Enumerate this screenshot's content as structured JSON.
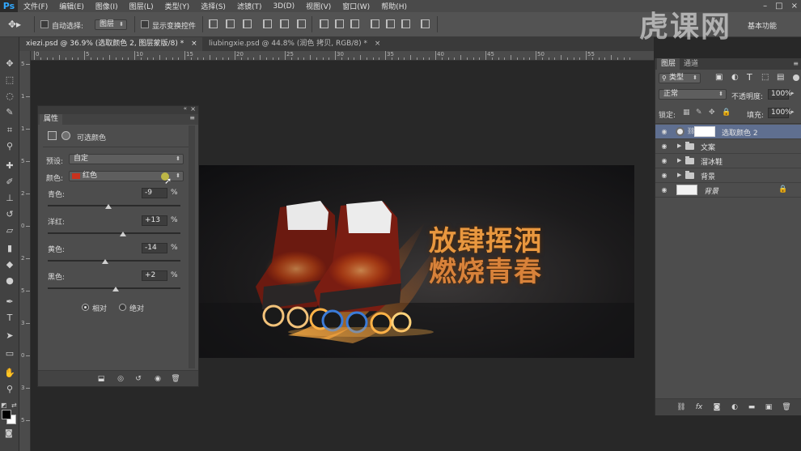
{
  "app": {
    "logo": "Ps"
  },
  "menu": [
    "文件(F)",
    "编辑(E)",
    "图像(I)",
    "图层(L)",
    "类型(Y)",
    "选择(S)",
    "滤镜(T)",
    "3D(D)",
    "视图(V)",
    "窗口(W)",
    "帮助(H)"
  ],
  "options": {
    "auto_select_label": "自动选择:",
    "auto_select_value": "图层",
    "show_transform_label": "显示变换控件",
    "right_text": "基本功能"
  },
  "tabs": [
    {
      "label": "xiezi.psd @ 36.9% (选取颜色 2, 图层蒙版/8) *",
      "close": "×"
    },
    {
      "label": "liubingxie.psd @ 44.8% (润色 拷贝, RGB/8) *",
      "close": "×"
    }
  ],
  "ruler": {
    "top": [
      "0",
      "5",
      "10",
      "15",
      "20",
      "25",
      "30",
      "35",
      "40",
      "45",
      "50",
      "55"
    ],
    "left": [
      "5",
      "1",
      "1",
      "5",
      "2",
      "0",
      "2",
      "5",
      "3",
      "0",
      "3",
      "5"
    ]
  },
  "properties": {
    "tab": "属性",
    "title": "可选颜色",
    "preset_label": "预设:",
    "preset_value": "自定",
    "color_label": "颜色:",
    "color_value": "红色",
    "color_swatch": "#c8321e",
    "sliders": [
      {
        "label": "青色:",
        "value": "-9",
        "unit": "%",
        "level": -9
      },
      {
        "label": "洋红:",
        "value": "+13",
        "unit": "%",
        "level": 13
      },
      {
        "label": "黄色:",
        "value": "-14",
        "unit": "%",
        "level": -14
      },
      {
        "label": "黑色:",
        "value": "+2",
        "unit": "%",
        "level": 2
      }
    ],
    "mode_relative": "相对",
    "mode_absolute": "绝对",
    "mode_selected": "相对"
  },
  "banner": {
    "line1": "放肆挥洒",
    "line2": "燃烧青春"
  },
  "layers_panel": {
    "tab_layers": "图层",
    "tab_channels": "通道",
    "filter_label": "类型",
    "blend_mode": "正常",
    "opacity_label": "不透明度:",
    "opacity_value": "100%",
    "lock_label": "锁定:",
    "fill_label": "填充:",
    "fill_value": "100%",
    "layers": [
      {
        "name": "选取颜色 2",
        "type": "adjustment",
        "selected": true
      },
      {
        "name": "文案",
        "type": "group",
        "selected": false
      },
      {
        "name": "溜冰鞋",
        "type": "group",
        "selected": false
      },
      {
        "name": "背景",
        "type": "group",
        "selected": false
      },
      {
        "name": "背景",
        "type": "background",
        "selected": false
      }
    ]
  },
  "watermark": "虎课网",
  "colors": {
    "accent": "#31a8ff",
    "selected_layer": "#5f6f90",
    "fire": "#ff9a2a"
  }
}
